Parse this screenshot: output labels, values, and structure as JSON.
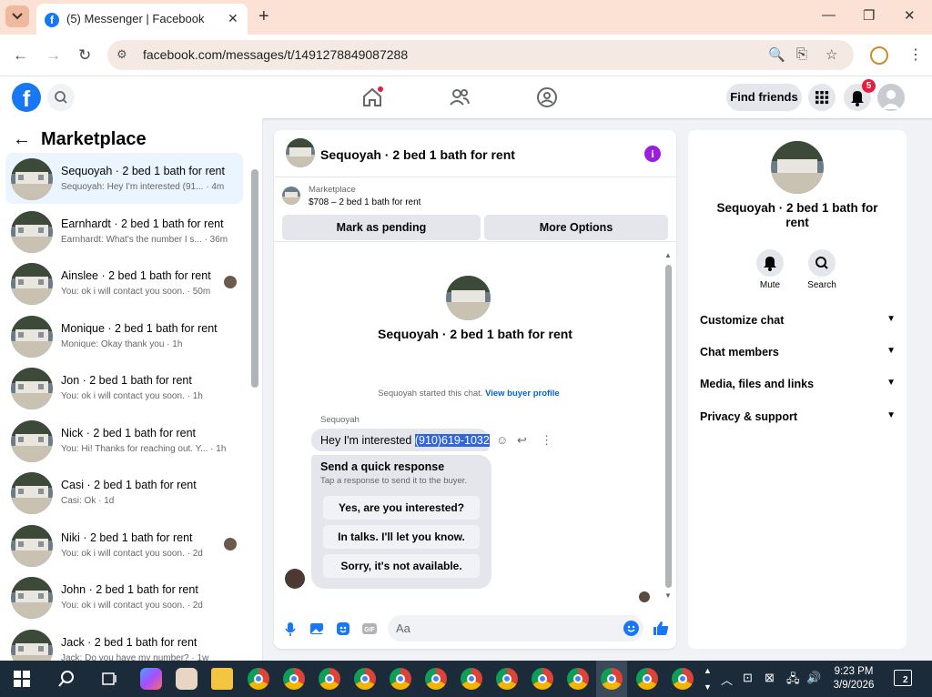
{
  "browser": {
    "tab_title": "(5) Messenger | Facebook",
    "url": "facebook.com/messages/t/1491278849087288"
  },
  "fb": {
    "find_friends_label": "Find friends",
    "notification_count": "5"
  },
  "left": {
    "title": "Marketplace",
    "conversations": [
      {
        "name": "Sequoyah · 2 bed 1 bath for rent",
        "preview": "Sequoyah: Hey I'm interested (91... · 4m",
        "active": true
      },
      {
        "name": "Earnhardt · 2 bed 1 bath for rent",
        "preview": "Earnhardt: What's the number I s... · 36m"
      },
      {
        "name": "Ainslee · 2 bed 1 bath for rent",
        "preview": "You: ok i will contact you soon. · 50m",
        "seen": true
      },
      {
        "name": "Monique · 2 bed 1 bath for rent",
        "preview": "Monique: Okay thank you · 1h"
      },
      {
        "name": "Jon · 2 bed 1 bath for rent",
        "preview": "You: ok i will contact you soon. · 1h"
      },
      {
        "name": "Nick · 2 bed 1 bath for rent",
        "preview": "You: Hi! Thanks for reaching out. Y... · 1h"
      },
      {
        "name": "Casi · 2 bed 1 bath for rent",
        "preview": "Casi: Ok · 1d"
      },
      {
        "name": "Niki · 2 bed 1 bath for rent",
        "preview": "You: ok i will contact you soon. · 2d",
        "seen": true
      },
      {
        "name": "John · 2 bed 1 bath for rent",
        "preview": "You: ok i will contact you soon. · 2d"
      },
      {
        "name": "Jack · 2 bed 1 bath for rent",
        "preview": "Jack: Do you have my number? · 1w"
      }
    ]
  },
  "chat": {
    "title": "Sequoyah · 2 bed 1 bath for rent",
    "listing_label": "Marketplace",
    "listing_price": "$708 – 2 bed 1 bath for rent",
    "mark_pending": "Mark as pending",
    "more_options": "More Options",
    "center_title": "Sequoyah · 2 bed 1 bath for rent",
    "started_text": "Sequoyah started this chat.",
    "view_profile": "View buyer profile",
    "sender": "Sequoyah",
    "message_plain": "Hey I'm interested ",
    "message_highlight": "(910)619-1032",
    "quick_title": "Send a quick response",
    "quick_sub": "Tap a response to send it to the buyer.",
    "quick_responses": [
      "Yes, are you interested?",
      "In talks. I'll let you know.",
      "Sorry, it's not available."
    ],
    "input_placeholder": "Aa"
  },
  "right": {
    "title": "Sequoyah · 2 bed 1 bath for rent",
    "mute_label": "Mute",
    "search_label": "Search",
    "sections": [
      "Customize chat",
      "Chat members",
      "Media, files and links",
      "Privacy & support"
    ]
  },
  "taskbar": {
    "time": "9:23 PM",
    "date": "3/9/2026",
    "notif_count": "2"
  }
}
